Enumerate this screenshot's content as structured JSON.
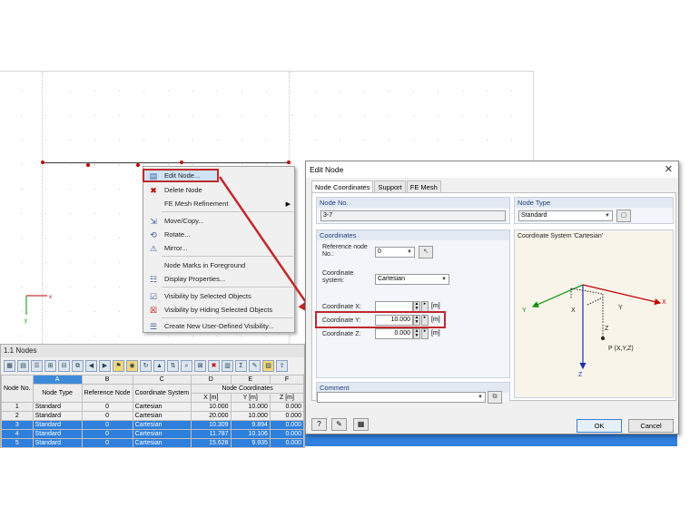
{
  "context_menu": {
    "items": [
      {
        "label": "Edit Node...",
        "icon": "edit-node-icon"
      },
      {
        "label": "Delete Node",
        "icon": "delete-icon"
      },
      {
        "label": "FE Mesh Refinement",
        "icon": ""
      },
      {
        "label": "Move/Copy...",
        "icon": "move-copy-icon"
      },
      {
        "label": "Rotate...",
        "icon": "rotate-icon"
      },
      {
        "label": "Mirror...",
        "icon": "mirror-icon"
      },
      {
        "label": "Node Marks in Foreground",
        "icon": ""
      },
      {
        "label": "Display Properties...",
        "icon": "display-properties-icon"
      },
      {
        "label": "Visibility by Selected Objects",
        "icon": "visibility-selected-icon"
      },
      {
        "label": "Visibility by Hiding Selected Objects",
        "icon": "visibility-hide-icon"
      },
      {
        "label": "Create New User-Defined Visibility...",
        "icon": "new-visibility-icon"
      }
    ]
  },
  "panel": {
    "title": "1.1 Nodes",
    "columns": [
      "A",
      "B",
      "C",
      "D",
      "E",
      "F"
    ],
    "headers": {
      "node_no": "Node No.",
      "node_type": "Node Type",
      "reference_node": "Reference Node",
      "coordinate_system": "Coordinate System",
      "node_coordinates": "Node Coordinates",
      "x": "X [m]",
      "y": "Y [m]",
      "z": "Z [m]"
    },
    "rows": [
      {
        "no": "1",
        "type": "Standard",
        "ref": "0",
        "cs": "Cartesian",
        "x": "10.000",
        "y": "10.000",
        "z": "0.000",
        "selected": false
      },
      {
        "no": "2",
        "type": "Standard",
        "ref": "0",
        "cs": "Cartesian",
        "x": "20.000",
        "y": "10.000",
        "z": "0.000",
        "selected": false
      },
      {
        "no": "3",
        "type": "Standard",
        "ref": "0",
        "cs": "Cartesian",
        "x": "10.309",
        "y": "9.894",
        "z": "0.000",
        "selected": true
      },
      {
        "no": "4",
        "type": "Standard",
        "ref": "0",
        "cs": "Cartesian",
        "x": "11.787",
        "y": "10.106",
        "z": "0.000",
        "selected": true
      },
      {
        "no": "5",
        "type": "Standard",
        "ref": "0",
        "cs": "Cartesian",
        "x": "15.628",
        "y": "9.935",
        "z": "0.000",
        "selected": true
      }
    ]
  },
  "dialog": {
    "title": "Edit Node",
    "tabs": [
      "Node Coordinates",
      "Support",
      "FE Mesh"
    ],
    "node_no_label": "Node No.",
    "node_no_value": "3-7",
    "node_type_label": "Node Type",
    "node_type_value": "Standard",
    "coordinates_label": "Coordinates",
    "reference_node_label": "Reference node No.:",
    "reference_node_value": "0",
    "coord_system_label": "Coordinate system:",
    "coord_system_value": "Cartesian",
    "coord_x_label": "Coordinate X:",
    "coord_x_value": "",
    "coord_y_label": "Coordinate Y:",
    "coord_y_value": "10.000",
    "coord_z_label": "Coordinate Z:",
    "coord_z_value": "0.000",
    "unit": "[m]",
    "comment_label": "Comment",
    "comment_value": "",
    "diagram_title": "Coordinate System 'Cartesian'",
    "diagram_labels": {
      "y_left": "Y",
      "x_mid": "X",
      "y_mid": "Y",
      "x_right": "X",
      "z_mid": "Z",
      "z_bottom": "Z",
      "p": "P (X,Y,Z)"
    },
    "ok_label": "OK",
    "cancel_label": "Cancel"
  },
  "colors": {
    "accent": "#2f7fdc",
    "highlight": "#c0282d"
  }
}
